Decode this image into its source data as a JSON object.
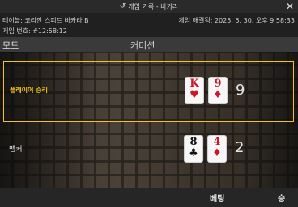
{
  "window": {
    "title": "게임 기록 - 바카라",
    "history_icon": "history-icon",
    "close_icon": "close-icon",
    "close_glyph": "✕",
    "history_glyph": "↺"
  },
  "info": {
    "table": "테이블: 코리안 스피드 바카라 B",
    "game_number": "게임 번호: #12:58:12",
    "resolved": "게임 해결됨: 2025. 5. 30. 오후 9:58:33"
  },
  "columns": {
    "mode": "모드",
    "commission": "커미션"
  },
  "results": {
    "player": {
      "label": "플레이어 승리",
      "cards": [
        {
          "rank": "K",
          "suit": "♥",
          "color": "red"
        },
        {
          "rank": "9",
          "suit": "♦",
          "color": "red"
        }
      ],
      "score": "9"
    },
    "banker": {
      "label": "뱅커",
      "cards": [
        {
          "rank": "8",
          "suit": "♣",
          "color": "black"
        },
        {
          "rank": "4",
          "suit": "♦",
          "color": "red"
        }
      ],
      "score": "2"
    }
  },
  "footer": {
    "bet": "베팅",
    "win": "승"
  },
  "colors": {
    "highlight": "#f0c419",
    "red_suit": "#d0142a"
  }
}
